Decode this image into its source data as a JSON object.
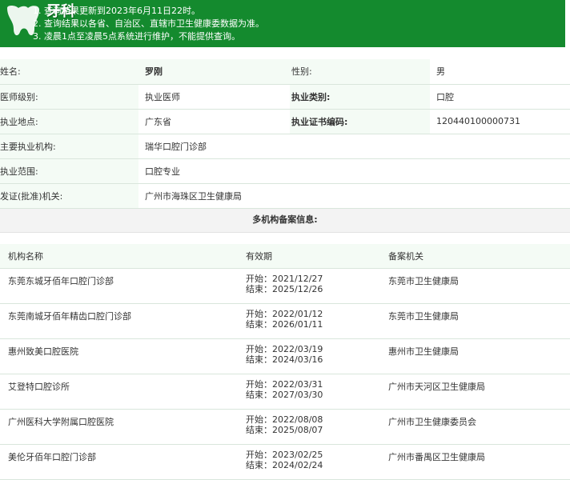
{
  "banner": {
    "logo_text": "牙科",
    "notes": [
      "1. 查询结果更新到2023年6月11日22时。",
      "2. 查询结果以各省、自治区、直辖市卫生健康委数据为准。",
      "3. 凌晨1点至凌晨5点系统进行维护，不能提供查询。"
    ]
  },
  "info": {
    "name_label": "姓名:",
    "name_value": "罗刚",
    "gender_label": "性别:",
    "gender_value": "男",
    "level_label": "医师级别:",
    "level_value": "执业医师",
    "type_label": "执业类别:",
    "type_value": "口腔",
    "place_label": "执业地点:",
    "place_value": "广东省",
    "cert_label": "执业证书编码:",
    "cert_value": "120440100000731",
    "org_label": "主要执业机构:",
    "org_value": "瑞华口腔门诊部",
    "scope_label": "执业范围:",
    "scope_value": "口腔专业",
    "issuer_label": "发证(批准)机关:",
    "issuer_value": "广州市海珠区卫生健康局"
  },
  "multi": {
    "title": "多机构备案信息:",
    "headers": [
      "机构名称",
      "有效期",
      "备案机关"
    ],
    "rows": [
      {
        "org": "东莞东城牙佰年口腔门诊部",
        "start": "开始：2021/12/27",
        "end": "结束：2025/12/26",
        "authority": "东莞市卫生健康局"
      },
      {
        "org": "东莞南城牙佰年精齿口腔门诊部",
        "start": "开始：2022/01/12",
        "end": "结束：2026/01/11",
        "authority": "东莞市卫生健康局"
      },
      {
        "org": "惠州致美口腔医院",
        "start": "开始：2022/03/19",
        "end": "结束：2024/03/16",
        "authority": "惠州市卫生健康局"
      },
      {
        "org": "艾登特口腔诊所",
        "start": "开始：2022/03/31",
        "end": "结束：2027/03/30",
        "authority": "广州市天河区卫生健康局"
      },
      {
        "org": "广州医科大学附属口腔医院",
        "start": "开始：2022/08/08",
        "end": "结束：2025/08/07",
        "authority": "广州市卫生健康委员会"
      },
      {
        "org": "美伦牙佰年口腔门诊部",
        "start": "开始：2023/02/25",
        "end": "结束：2024/02/24",
        "authority": "广州市番禺区卫生健康局"
      }
    ]
  },
  "colors": {
    "banner": "#148a2e",
    "row_bg": "#f4fbf5",
    "border": "#d9e6dc"
  }
}
